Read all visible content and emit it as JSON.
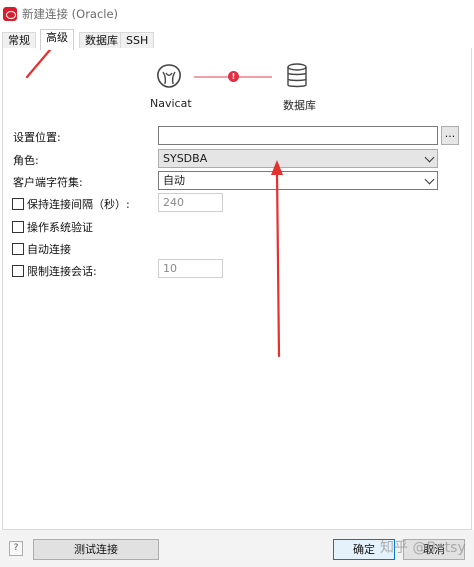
{
  "window": {
    "title": "新建连接 (Oracle)"
  },
  "tabs": [
    {
      "label": "常规",
      "active": false
    },
    {
      "label": "高级",
      "active": true
    },
    {
      "label": "数据库",
      "active": false
    },
    {
      "label": "SSH",
      "active": false
    }
  ],
  "diagram": {
    "left_label": "Navicat",
    "right_label": "数据库"
  },
  "form": {
    "settings_location": {
      "label": "设置位置:",
      "value": "",
      "browse_label": "..."
    },
    "role": {
      "label": "角色:",
      "value": "SYSDBA"
    },
    "client_charset": {
      "label": "客户端字符集:",
      "value": "自动"
    },
    "keepalive": {
      "label": "保持连接间隔（秒）:",
      "checked": false,
      "value": "240"
    },
    "os_auth": {
      "label": "操作系统验证",
      "checked": false
    },
    "auto_connect": {
      "label": "自动连接",
      "checked": false
    },
    "limit_sessions": {
      "label": "限制连接会话:",
      "checked": false,
      "value": "10"
    }
  },
  "footer": {
    "test_button": "测试连接",
    "ok_button": "确定",
    "cancel_button": "取消",
    "watermark": "知乎 @Betsy"
  },
  "colors": {
    "annotation_arrow": "#e53030",
    "accent": "#0078d7",
    "brand": "#d81e2c"
  },
  "icons": [
    "navicat-icon",
    "database-icon",
    "error-dot-icon",
    "chevron-down-icon",
    "help-icon",
    "app-icon"
  ]
}
